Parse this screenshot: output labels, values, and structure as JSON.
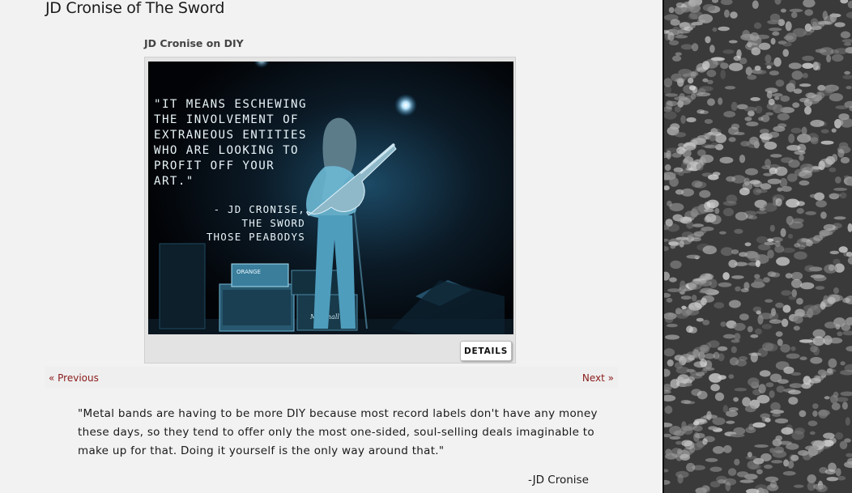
{
  "post": {
    "title": "JD Cronise of The Sword"
  },
  "gallery": {
    "caption": "JD Cronise on DIY",
    "image_quote": "\"IT MEANS ESCHEWING\nTHE INVOLVEMENT OF\nEXTRANEOUS ENTITIES\nWHO ARE LOOKING TO\nPROFIT OFF YOUR\nART.\"",
    "image_attribution": "- JD CRONISE,\nTHE SWORD\nTHOSE PEABODYS",
    "amp_label_top": "ORANGE",
    "amp_label_bottom": "Marshall",
    "details_label": "DETAILS"
  },
  "pager": {
    "previous_label": "« Previous",
    "next_label": "Next »",
    "link_color": "#8b1a1a"
  },
  "quote": {
    "text": "\"Metal bands are having to be more DIY because most record labels don't have any money these days, so they tend to offer only the most one-sided, soul-selling deals imaginable to make up for that. Doing it yourself is the only way around that.\"",
    "author": "-JD Cronise"
  }
}
